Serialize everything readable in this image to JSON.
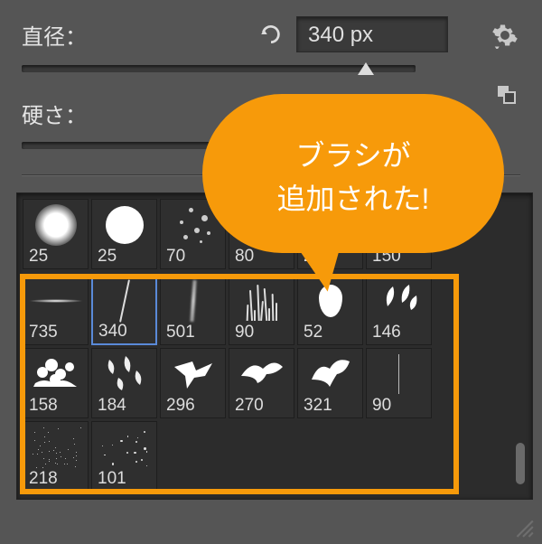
{
  "diameter": {
    "label": "直径：",
    "value": "340 px",
    "slider_percent": 86
  },
  "hardness": {
    "label": "硬さ：",
    "slider_percent": 0
  },
  "callout": {
    "line1": "ブラシが",
    "line2": "追加された!"
  },
  "brushes_row1": [
    {
      "size": "25",
      "kind": "soft-round"
    },
    {
      "size": "25",
      "kind": "hard-round"
    },
    {
      "size": "70",
      "kind": "dots"
    },
    {
      "size": "80",
      "kind": "scratch"
    },
    {
      "size": "250",
      "kind": "scratch-wide"
    },
    {
      "size": "150",
      "kind": "scratch-tall"
    }
  ],
  "brushes_added": [
    {
      "size": "735",
      "kind": "flare",
      "selected": false
    },
    {
      "size": "340",
      "kind": "thin-stroke",
      "selected": true
    },
    {
      "size": "501",
      "kind": "fuzzy-stroke",
      "selected": false
    },
    {
      "size": "90",
      "kind": "grass",
      "selected": false
    },
    {
      "size": "52",
      "kind": "drop",
      "selected": false
    },
    {
      "size": "146",
      "kind": "leaves",
      "selected": false
    },
    {
      "size": "158",
      "kind": "flowers",
      "selected": false
    },
    {
      "size": "184",
      "kind": "falling-leaves",
      "selected": false
    },
    {
      "size": "296",
      "kind": "bird-a",
      "selected": false
    },
    {
      "size": "270",
      "kind": "bird-b",
      "selected": false
    },
    {
      "size": "321",
      "kind": "bird-c",
      "selected": false
    },
    {
      "size": "90",
      "kind": "thin-line",
      "selected": false
    },
    {
      "size": "218",
      "kind": "speckle",
      "selected": false
    },
    {
      "size": "101",
      "kind": "sparkle",
      "selected": false
    }
  ]
}
